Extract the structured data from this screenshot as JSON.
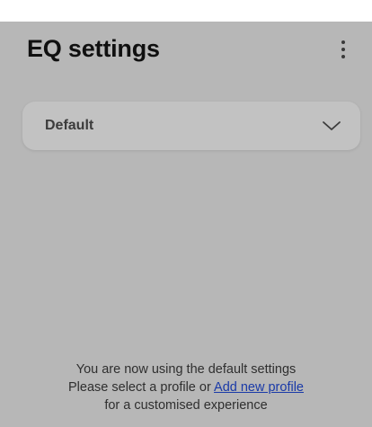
{
  "header": {
    "title": "EQ settings",
    "menu_icon": "more-vertical-icon"
  },
  "profile_select": {
    "selected": "Default",
    "icon": "chevron-down-icon"
  },
  "footer": {
    "line1": "You are now using the default settings",
    "line2_prefix": "Please select a profile or ",
    "add_profile_link": "Add new profile",
    "line3": "for a customised experience"
  },
  "colors": {
    "background": "#b7b7b7",
    "card": "#c2c2c2",
    "link": "#1a3aa8",
    "title": "#101010"
  }
}
